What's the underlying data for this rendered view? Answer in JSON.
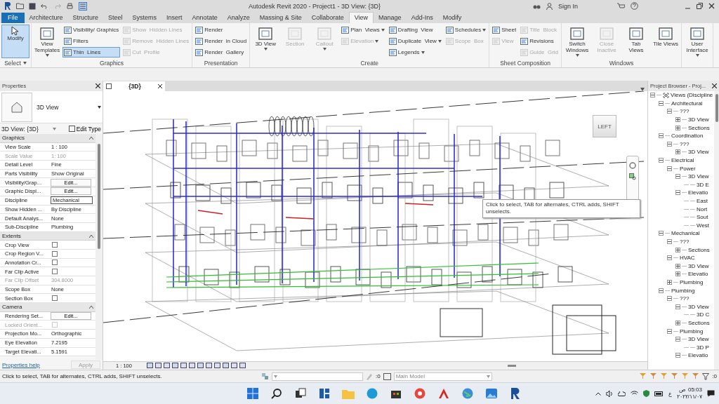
{
  "window": {
    "title": "Autodesk Revit 2020 - Project1 - 3D View: {3D}",
    "sign_in": "Sign In"
  },
  "tabs": [
    {
      "label": "File",
      "selected": false,
      "kind": "file"
    },
    {
      "label": "Architecture",
      "selected": false,
      "kind": "tab"
    },
    {
      "label": "Structure",
      "selected": false,
      "kind": "tab"
    },
    {
      "label": "Steel",
      "selected": false,
      "kind": "tab"
    },
    {
      "label": "Systems",
      "selected": false,
      "kind": "tab"
    },
    {
      "label": "Insert",
      "selected": false,
      "kind": "tab"
    },
    {
      "label": "Annotate",
      "selected": false,
      "kind": "tab"
    },
    {
      "label": "Analyze",
      "selected": false,
      "kind": "tab"
    },
    {
      "label": "Massing & Site",
      "selected": false,
      "kind": "tab"
    },
    {
      "label": "Collaborate",
      "selected": false,
      "kind": "tab"
    },
    {
      "label": "View",
      "selected": true,
      "kind": "tab"
    },
    {
      "label": "Manage",
      "selected": false,
      "kind": "tab"
    },
    {
      "label": "Add-Ins",
      "selected": false,
      "kind": "tab"
    },
    {
      "label": "Modify",
      "selected": false,
      "kind": "tab"
    }
  ],
  "ribbon": {
    "panels": [
      {
        "label": "Select",
        "menu": true,
        "columns": [
          [
            {
              "kind": "large",
              "label": "Modify",
              "disabled": false,
              "on": true,
              "menu": false
            }
          ]
        ]
      },
      {
        "label": "Graphics",
        "columns": [
          [
            {
              "kind": "large",
              "label": "View Templates",
              "disabled": false,
              "on": false,
              "menu": true
            }
          ],
          [
            {
              "kind": "small",
              "label": "Visibility/ Graphics",
              "disabled": false,
              "on": false,
              "menu": false
            },
            {
              "kind": "small",
              "label": "Filters",
              "disabled": false,
              "on": false,
              "menu": false
            },
            {
              "kind": "small",
              "label": "Thin  Lines",
              "disabled": false,
              "on": true,
              "menu": false
            }
          ],
          [
            {
              "kind": "small",
              "label": "Show  Hidden Lines",
              "disabled": true,
              "on": false,
              "menu": false
            },
            {
              "kind": "small",
              "label": "Remove  Hidden Lines",
              "disabled": true,
              "on": false,
              "menu": false
            },
            {
              "kind": "small",
              "label": "Cut  Profile",
              "disabled": true,
              "on": false,
              "menu": false
            }
          ]
        ]
      },
      {
        "label": "Presentation",
        "columns": [
          [
            {
              "kind": "small",
              "label": "Render",
              "disabled": false,
              "on": false,
              "menu": false
            },
            {
              "kind": "small",
              "label": "Render  in Cloud",
              "disabled": false,
              "on": false,
              "menu": false
            },
            {
              "kind": "small",
              "label": "Render  Gallery",
              "disabled": false,
              "on": false,
              "menu": false
            }
          ]
        ]
      },
      {
        "label": "Create",
        "columns": [
          [
            {
              "kind": "large",
              "label": "3D View",
              "disabled": false,
              "on": false,
              "menu": true
            }
          ],
          [
            {
              "kind": "large",
              "label": "Section",
              "disabled": true,
              "on": false,
              "menu": false
            }
          ],
          [
            {
              "kind": "large",
              "label": "Callout",
              "disabled": true,
              "on": false,
              "menu": true
            }
          ],
          [
            {
              "kind": "small",
              "label": "Plan  Views",
              "disabled": false,
              "on": false,
              "menu": true
            },
            {
              "kind": "small",
              "label": "Elevation",
              "disabled": true,
              "on": false,
              "menu": true
            }
          ],
          [
            {
              "kind": "small",
              "label": "Drafting  View",
              "disabled": false,
              "on": false,
              "menu": false
            },
            {
              "kind": "small",
              "label": "Duplicate  View",
              "disabled": false,
              "on": false,
              "menu": true
            },
            {
              "kind": "small",
              "label": "Legends",
              "disabled": false,
              "on": false,
              "menu": true
            }
          ],
          [
            {
              "kind": "small",
              "label": "Schedules",
              "disabled": false,
              "on": false,
              "menu": true
            },
            {
              "kind": "small",
              "label": "Scope  Box",
              "disabled": true,
              "on": false,
              "menu": false
            }
          ]
        ]
      },
      {
        "label": "Sheet Composition",
        "columns": [
          [
            {
              "kind": "small",
              "label": "Sheet",
              "disabled": false,
              "on": false,
              "menu": false
            },
            {
              "kind": "small",
              "label": "View",
              "disabled": true,
              "on": false,
              "menu": false
            }
          ],
          [
            {
              "kind": "small",
              "label": "Title  Block",
              "disabled": true,
              "on": false,
              "menu": false
            },
            {
              "kind": "small",
              "label": "Revisions",
              "disabled": false,
              "on": false,
              "menu": false
            },
            {
              "kind": "small",
              "label": "Guide  Grid",
              "disabled": true,
              "on": false,
              "menu": false
            }
          ]
        ]
      },
      {
        "label": "Windows",
        "columns": [
          [
            {
              "kind": "large",
              "label": "Switch Windows",
              "disabled": false,
              "on": false,
              "menu": true
            }
          ],
          [
            {
              "kind": "large",
              "label": "Close Inactive",
              "disabled": true,
              "on": false,
              "menu": false
            }
          ],
          [
            {
              "kind": "large",
              "label": "Tab Views",
              "disabled": false,
              "on": false,
              "menu": false
            }
          ],
          [
            {
              "kind": "large",
              "label": "Tile Views",
              "disabled": false,
              "on": false,
              "menu": false
            }
          ]
        ]
      },
      {
        "columns": [
          [
            {
              "kind": "large",
              "label": "User Interface",
              "disabled": false,
              "on": false,
              "menu": true
            }
          ]
        ]
      }
    ]
  },
  "properties": {
    "title": "Properties",
    "type_name": "3D View",
    "instance": "3D View: {3D}",
    "edit_type": "Edit Type",
    "rows": [
      {
        "kind": "header",
        "label": "Graphics",
        "expanded": true
      },
      {
        "kind": "text",
        "label": "View Scale",
        "value": "1 : 100",
        "disabled": false
      },
      {
        "kind": "text",
        "label": "Scale Value",
        "value": "1: 100",
        "disabled": true
      },
      {
        "kind": "text",
        "label": "Detail Level",
        "value": "Fine",
        "disabled": false
      },
      {
        "kind": "text",
        "label": "Parts Visibility",
        "value": "Show Original",
        "disabled": false
      },
      {
        "kind": "button",
        "label": "Visibility/Grap...",
        "value": "Edit...",
        "disabled": false
      },
      {
        "kind": "button",
        "label": "Graphic Displ...",
        "value": "Edit...",
        "disabled": false
      },
      {
        "kind": "field",
        "label": "Discipline",
        "value": "Mechanical",
        "disabled": false
      },
      {
        "kind": "text",
        "label": "Show Hidden ...",
        "value": "By Discipline",
        "disabled": false
      },
      {
        "kind": "text",
        "label": "Default Analys...",
        "value": "None",
        "disabled": false
      },
      {
        "kind": "text",
        "label": "Sub-Discipline",
        "value": "Plumbing",
        "disabled": false
      },
      {
        "kind": "header",
        "label": "Extents",
        "expanded": true
      },
      {
        "kind": "checkbox",
        "label": "Crop View",
        "checked": false,
        "disabled": false
      },
      {
        "kind": "checkbox",
        "label": "Crop Region V...",
        "checked": false,
        "disabled": false
      },
      {
        "kind": "checkbox",
        "label": "Annotation Cr...",
        "checked": false,
        "disabled": false
      },
      {
        "kind": "checkbox",
        "label": "Far Clip Active",
        "checked": false,
        "disabled": false
      },
      {
        "kind": "text",
        "label": "Far Clip Offset",
        "value": "304.8000",
        "disabled": true
      },
      {
        "kind": "text",
        "label": "Scope Box",
        "value": "None",
        "disabled": false
      },
      {
        "kind": "checkbox",
        "label": "Section Box",
        "checked": false,
        "disabled": false
      },
      {
        "kind": "header",
        "label": "Camera",
        "expanded": true
      },
      {
        "kind": "button",
        "label": "Rendering Set...",
        "value": "Edit...",
        "disabled": false
      },
      {
        "kind": "checkbox",
        "label": "Locked Orient...",
        "checked": false,
        "disabled": true
      },
      {
        "kind": "text",
        "label": "Projection Mo...",
        "value": "Orthographic",
        "disabled": false
      },
      {
        "kind": "text",
        "label": "Eye Elevation",
        "value": "7.2195",
        "disabled": false
      },
      {
        "kind": "text",
        "label": "Target Elevati...",
        "value": "5.1591",
        "disabled": false
      }
    ],
    "help": "Properties help",
    "apply": "Apply",
    "apply_disabled": true
  },
  "view": {
    "tab": "{3D}",
    "viewcube": "LEFT",
    "scale": "1 : 100",
    "tooltip": "Click to select, TAB for alternates, CTRL adds, SHIFT unselects."
  },
  "browser": {
    "title": "Project Browser - Proj...",
    "tree": [
      {
        "label": "Views (Discipline",
        "expanded": true,
        "children": [
          {
            "label": "Architectural",
            "expanded": true,
            "children": [
              {
                "label": "???",
                "expanded": true,
                "children": [
                  {
                    "label": "3D View",
                    "expanded": false
                  },
                  {
                    "label": "Sections",
                    "expanded": false
                  }
                ]
              }
            ]
          },
          {
            "label": "Coordination",
            "expanded": true,
            "children": [
              {
                "label": "???",
                "expanded": true,
                "children": [
                  {
                    "label": "3D View",
                    "expanded": false
                  }
                ]
              }
            ]
          },
          {
            "label": "Electrical",
            "expanded": true,
            "children": [
              {
                "label": "Power",
                "expanded": true,
                "children": [
                  {
                    "label": "3D View",
                    "expanded": true,
                    "children": [
                      {
                        "label": "3D E"
                      }
                    ]
                  },
                  {
                    "label": "Elevatio",
                    "expanded": true,
                    "children": [
                      {
                        "label": "East"
                      },
                      {
                        "label": "Nort"
                      },
                      {
                        "label": "Sout"
                      },
                      {
                        "label": "West"
                      }
                    ]
                  }
                ]
              }
            ]
          },
          {
            "label": "Mechanical",
            "expanded": true,
            "children": [
              {
                "label": "???",
                "expanded": true,
                "children": [
                  {
                    "label": "Sections",
                    "expanded": false
                  }
                ]
              },
              {
                "label": "HVAC",
                "expanded": true,
                "children": [
                  {
                    "label": "3D View",
                    "expanded": false
                  },
                  {
                    "label": "Elevatio",
                    "expanded": false
                  }
                ]
              },
              {
                "label": "Plumbing",
                "expanded": false
              }
            ]
          },
          {
            "label": "Plumbing",
            "expanded": true,
            "children": [
              {
                "label": "???",
                "expanded": true,
                "children": [
                  {
                    "label": "3D View",
                    "expanded": true,
                    "children": [
                      {
                        "label": "3D C"
                      }
                    ]
                  },
                  {
                    "label": "Sections",
                    "expanded": false
                  }
                ]
              },
              {
                "label": "Plumbing",
                "expanded": true,
                "children": [
                  {
                    "label": "3D View",
                    "expanded": true,
                    "children": [
                      {
                        "label": "3D P"
                      }
                    ]
                  },
                  {
                    "label": "Elevatio",
                    "expanded": true
                  }
                ]
              }
            ]
          }
        ]
      }
    ]
  },
  "status_bar": {
    "message": "Click to select, TAB for alternates, CTRL adds, SHIFT unselects.",
    "workset_count": ":0",
    "model": "Main Model",
    "filter_count": ":0"
  },
  "taskbar": {
    "input_language": "ع",
    "time": "05:03",
    "period": "ص",
    "date": "٢٠٢٢/١١/٠٧"
  }
}
